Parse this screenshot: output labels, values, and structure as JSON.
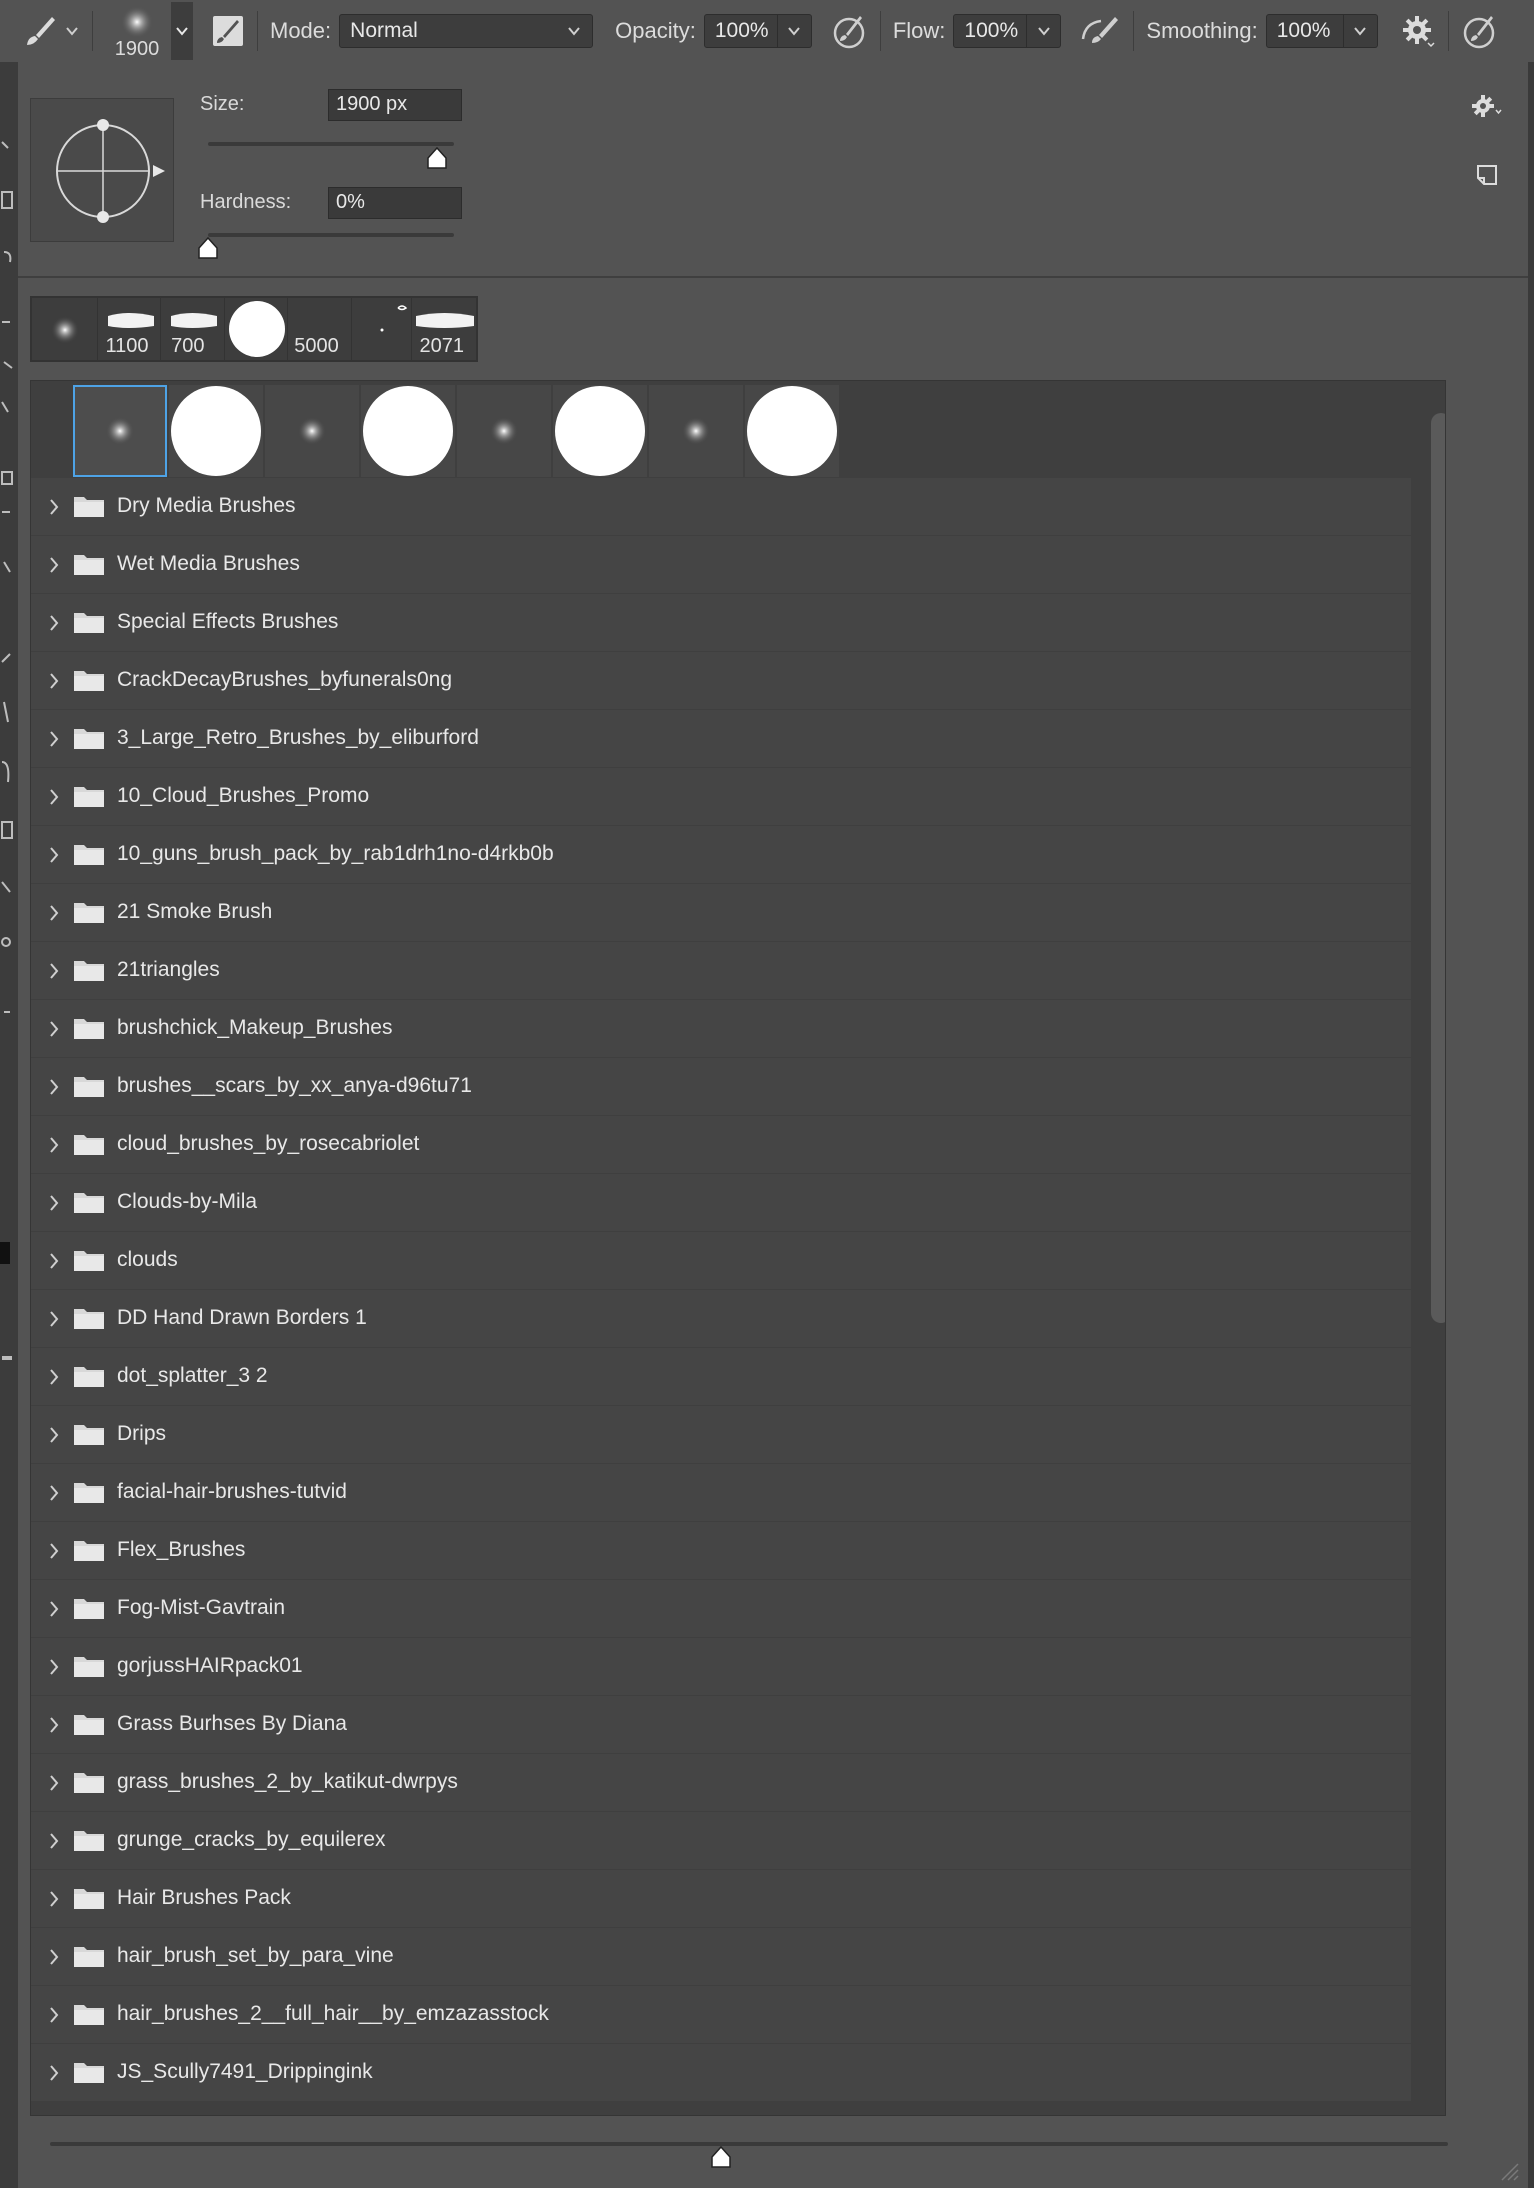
{
  "toolbar": {
    "brush_size": "1900",
    "mode_label": "Mode:",
    "mode_value": "Normal",
    "opacity_label": "Opacity:",
    "opacity_value": "100%",
    "flow_label": "Flow:",
    "flow_value": "100%",
    "smoothing_label": "Smoothing:",
    "smoothing_value": "100%",
    "icons": [
      "brush-tool-icon",
      "brush-preset-icon",
      "brush-settings-panel-icon",
      "pressure-opacity-icon",
      "airbrush-icon",
      "gear-icon",
      "pressure-size-icon"
    ]
  },
  "brush_panel": {
    "size_label": "Size:",
    "size_value": "1900 px",
    "size_level": 0.93,
    "hardness_label": "Hardness:",
    "hardness_value": "0%",
    "hardness_level": 0.0,
    "recent_brushes": [
      "",
      "1100",
      "700",
      "",
      "5000",
      "",
      "2071"
    ],
    "bottom_slider_level": 0.48
  },
  "folders": [
    "Dry Media Brushes",
    "Wet Media Brushes",
    "Special Effects Brushes",
    "CrackDecayBrushes_byfunerals0ng",
    "3_Large_Retro_Brushes_by_eliburford",
    "10_Cloud_Brushes_Promo",
    "10_guns_brush_pack_by_rab1drh1no-d4rkb0b",
    "21 Smoke Brush",
    "21triangles",
    "brushchick_Makeup_Brushes",
    "brushes__scars_by_xx_anya-d96tu71",
    "cloud_brushes_by_rosecabriolet",
    "Clouds-by-Mila",
    "clouds",
    "DD Hand Drawn Borders 1",
    "dot_splatter_3 2",
    "Drips",
    "facial-hair-brushes-tutvid",
    "Flex_Brushes",
    "Fog-Mist-Gavtrain",
    "gorjussHAIRpack01",
    "Grass Burhses By Diana",
    "grass_brushes_2_by_katikut-dwrpys",
    "grunge_cracks_by_equilerex",
    "Hair Brushes Pack",
    "hair_brush_set_by_para_vine",
    "hair_brushes_2__full_hair__by_emzazasstock",
    "JS_Scully7491_Drippingink"
  ]
}
